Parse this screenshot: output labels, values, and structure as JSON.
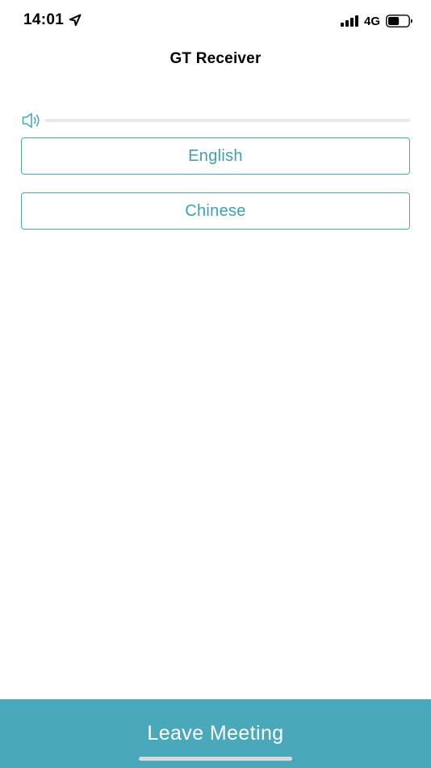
{
  "status_bar": {
    "time": "14:01",
    "location_icon": "location-arrow-icon",
    "signal_icon": "cellular-signal-icon",
    "network": "4G",
    "battery_icon": "battery-icon",
    "battery_level": 0.55
  },
  "header": {
    "title": "GT Receiver"
  },
  "volume": {
    "icon": "speaker-icon",
    "level": 0
  },
  "languages": [
    {
      "label": "English"
    },
    {
      "label": "Chinese"
    }
  ],
  "footer": {
    "leave_label": "Leave Meeting"
  },
  "colors": {
    "accent": "#4aa8bb",
    "accent_text": "#3e9fb2",
    "track": "#e8e8ec",
    "footer_text": "#ffffff"
  }
}
